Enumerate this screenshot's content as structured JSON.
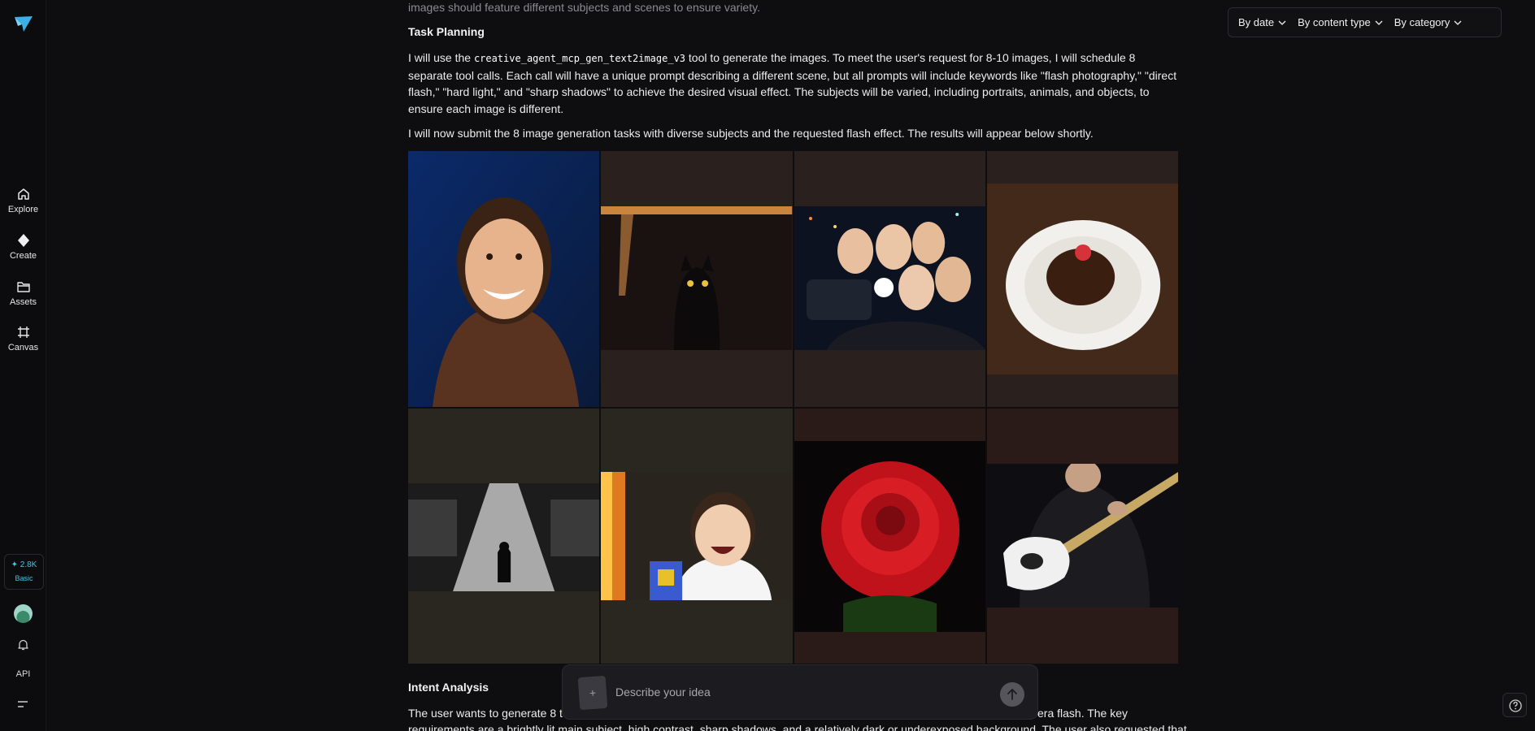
{
  "sidebar": {
    "items": [
      {
        "label": "Explore",
        "icon": "home-icon"
      },
      {
        "label": "Create",
        "icon": "diamond-icon"
      },
      {
        "label": "Assets",
        "icon": "folder-icon"
      },
      {
        "label": "Canvas",
        "icon": "canvas-icon"
      }
    ],
    "credits": {
      "value": "✦ 2.8K",
      "tier": "Basic"
    },
    "api_label": "API"
  },
  "filters": {
    "by_date": "By date",
    "by_content_type": "By content type",
    "by_category": "By category"
  },
  "content": {
    "faded_line": "images should feature different subjects and scenes to ensure variety.",
    "task_planning_heading": "Task Planning",
    "task_planning_pre": "I will use the ",
    "tool_name": "creative_agent_mcp_gen_text2image_v3",
    "task_planning_post": " tool to generate the images. To meet the user's request for 8-10 images, I will schedule 8 separate tool calls. Each call will have a unique prompt describing a different scene, but all prompts will include keywords like \"flash photography,\" \"direct flash,\" \"hard light,\" and \"sharp shadows\" to achieve the desired visual effect. The subjects will be varied, including portraits, animals, and objects, to ensure each image is different.",
    "submit_text": "I will now submit the 8 image generation tasks with diverse subjects and the requested flash effect. The results will appear below shortly.",
    "intent_heading": "Intent Analysis",
    "intent_text_left": "The user wants to generate 8 to",
    "intent_text_right": "era flash. The key",
    "intent_text_line2": "requirements are a brightly lit main subject, high contrast, sharp shadows, and a relatively dark or underexposed background. The user also requested that"
  },
  "images": [
    {
      "name": "smiling-woman-image"
    },
    {
      "name": "black-cat-image"
    },
    {
      "name": "group-selfie-image"
    },
    {
      "name": "chocolate-cake-image"
    },
    {
      "name": "silhouette-warehouse-image"
    },
    {
      "name": "laughing-child-image"
    },
    {
      "name": "red-rose-image"
    },
    {
      "name": "guitarist-image"
    }
  ],
  "prompt": {
    "placeholder": "Describe your idea",
    "attach_icon": "plus-icon",
    "send_icon": "arrow-up-icon"
  },
  "colors": {
    "accent": "#3cc8e6",
    "logo": "#3ab0e8",
    "background": "#0e0e10"
  }
}
